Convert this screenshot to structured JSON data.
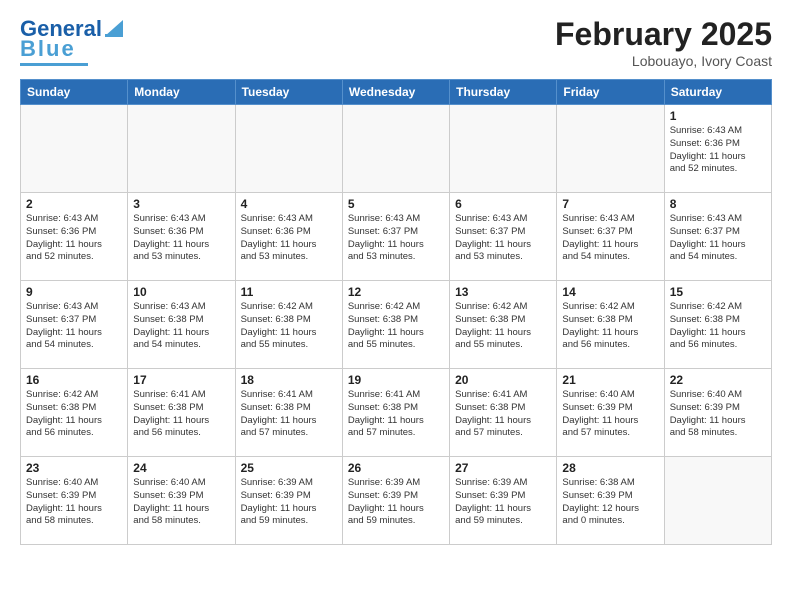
{
  "header": {
    "logo_general": "General",
    "logo_blue": "Blue",
    "month_year": "February 2025",
    "location": "Lobouayo, Ivory Coast"
  },
  "days_of_week": [
    "Sunday",
    "Monday",
    "Tuesday",
    "Wednesday",
    "Thursday",
    "Friday",
    "Saturday"
  ],
  "weeks": [
    [
      {
        "day": "",
        "info": ""
      },
      {
        "day": "",
        "info": ""
      },
      {
        "day": "",
        "info": ""
      },
      {
        "day": "",
        "info": ""
      },
      {
        "day": "",
        "info": ""
      },
      {
        "day": "",
        "info": ""
      },
      {
        "day": "1",
        "info": "Sunrise: 6:43 AM\nSunset: 6:36 PM\nDaylight: 11 hours\nand 52 minutes."
      }
    ],
    [
      {
        "day": "2",
        "info": "Sunrise: 6:43 AM\nSunset: 6:36 PM\nDaylight: 11 hours\nand 52 minutes."
      },
      {
        "day": "3",
        "info": "Sunrise: 6:43 AM\nSunset: 6:36 PM\nDaylight: 11 hours\nand 53 minutes."
      },
      {
        "day": "4",
        "info": "Sunrise: 6:43 AM\nSunset: 6:36 PM\nDaylight: 11 hours\nand 53 minutes."
      },
      {
        "day": "5",
        "info": "Sunrise: 6:43 AM\nSunset: 6:37 PM\nDaylight: 11 hours\nand 53 minutes."
      },
      {
        "day": "6",
        "info": "Sunrise: 6:43 AM\nSunset: 6:37 PM\nDaylight: 11 hours\nand 53 minutes."
      },
      {
        "day": "7",
        "info": "Sunrise: 6:43 AM\nSunset: 6:37 PM\nDaylight: 11 hours\nand 54 minutes."
      },
      {
        "day": "8",
        "info": "Sunrise: 6:43 AM\nSunset: 6:37 PM\nDaylight: 11 hours\nand 54 minutes."
      }
    ],
    [
      {
        "day": "9",
        "info": "Sunrise: 6:43 AM\nSunset: 6:37 PM\nDaylight: 11 hours\nand 54 minutes."
      },
      {
        "day": "10",
        "info": "Sunrise: 6:43 AM\nSunset: 6:38 PM\nDaylight: 11 hours\nand 54 minutes."
      },
      {
        "day": "11",
        "info": "Sunrise: 6:42 AM\nSunset: 6:38 PM\nDaylight: 11 hours\nand 55 minutes."
      },
      {
        "day": "12",
        "info": "Sunrise: 6:42 AM\nSunset: 6:38 PM\nDaylight: 11 hours\nand 55 minutes."
      },
      {
        "day": "13",
        "info": "Sunrise: 6:42 AM\nSunset: 6:38 PM\nDaylight: 11 hours\nand 55 minutes."
      },
      {
        "day": "14",
        "info": "Sunrise: 6:42 AM\nSunset: 6:38 PM\nDaylight: 11 hours\nand 56 minutes."
      },
      {
        "day": "15",
        "info": "Sunrise: 6:42 AM\nSunset: 6:38 PM\nDaylight: 11 hours\nand 56 minutes."
      }
    ],
    [
      {
        "day": "16",
        "info": "Sunrise: 6:42 AM\nSunset: 6:38 PM\nDaylight: 11 hours\nand 56 minutes."
      },
      {
        "day": "17",
        "info": "Sunrise: 6:41 AM\nSunset: 6:38 PM\nDaylight: 11 hours\nand 56 minutes."
      },
      {
        "day": "18",
        "info": "Sunrise: 6:41 AM\nSunset: 6:38 PM\nDaylight: 11 hours\nand 57 minutes."
      },
      {
        "day": "19",
        "info": "Sunrise: 6:41 AM\nSunset: 6:38 PM\nDaylight: 11 hours\nand 57 minutes."
      },
      {
        "day": "20",
        "info": "Sunrise: 6:41 AM\nSunset: 6:38 PM\nDaylight: 11 hours\nand 57 minutes."
      },
      {
        "day": "21",
        "info": "Sunrise: 6:40 AM\nSunset: 6:39 PM\nDaylight: 11 hours\nand 57 minutes."
      },
      {
        "day": "22",
        "info": "Sunrise: 6:40 AM\nSunset: 6:39 PM\nDaylight: 11 hours\nand 58 minutes."
      }
    ],
    [
      {
        "day": "23",
        "info": "Sunrise: 6:40 AM\nSunset: 6:39 PM\nDaylight: 11 hours\nand 58 minutes."
      },
      {
        "day": "24",
        "info": "Sunrise: 6:40 AM\nSunset: 6:39 PM\nDaylight: 11 hours\nand 58 minutes."
      },
      {
        "day": "25",
        "info": "Sunrise: 6:39 AM\nSunset: 6:39 PM\nDaylight: 11 hours\nand 59 minutes."
      },
      {
        "day": "26",
        "info": "Sunrise: 6:39 AM\nSunset: 6:39 PM\nDaylight: 11 hours\nand 59 minutes."
      },
      {
        "day": "27",
        "info": "Sunrise: 6:39 AM\nSunset: 6:39 PM\nDaylight: 11 hours\nand 59 minutes."
      },
      {
        "day": "28",
        "info": "Sunrise: 6:38 AM\nSunset: 6:39 PM\nDaylight: 12 hours\nand 0 minutes."
      },
      {
        "day": "",
        "info": ""
      }
    ]
  ]
}
